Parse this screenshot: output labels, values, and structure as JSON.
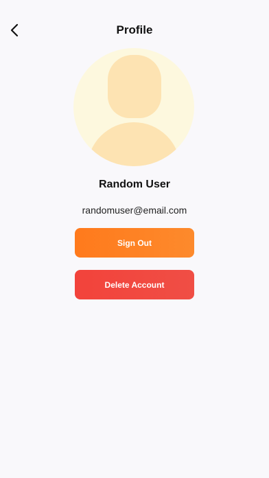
{
  "header": {
    "title": "Profile",
    "back_icon": "chevron-left-icon"
  },
  "profile": {
    "avatar_icon": "user-placeholder-icon",
    "name": "Random User",
    "email": "randomuser@email.com"
  },
  "actions": {
    "sign_out_label": "Sign Out",
    "delete_account_label": "Delete Account"
  },
  "colors": {
    "background": "#f9f8fb",
    "sign_out": "#ff7a1c",
    "delete_account": "#f2433b",
    "avatar_bg": "#fdf8de",
    "avatar_fg": "#fde3b2"
  }
}
